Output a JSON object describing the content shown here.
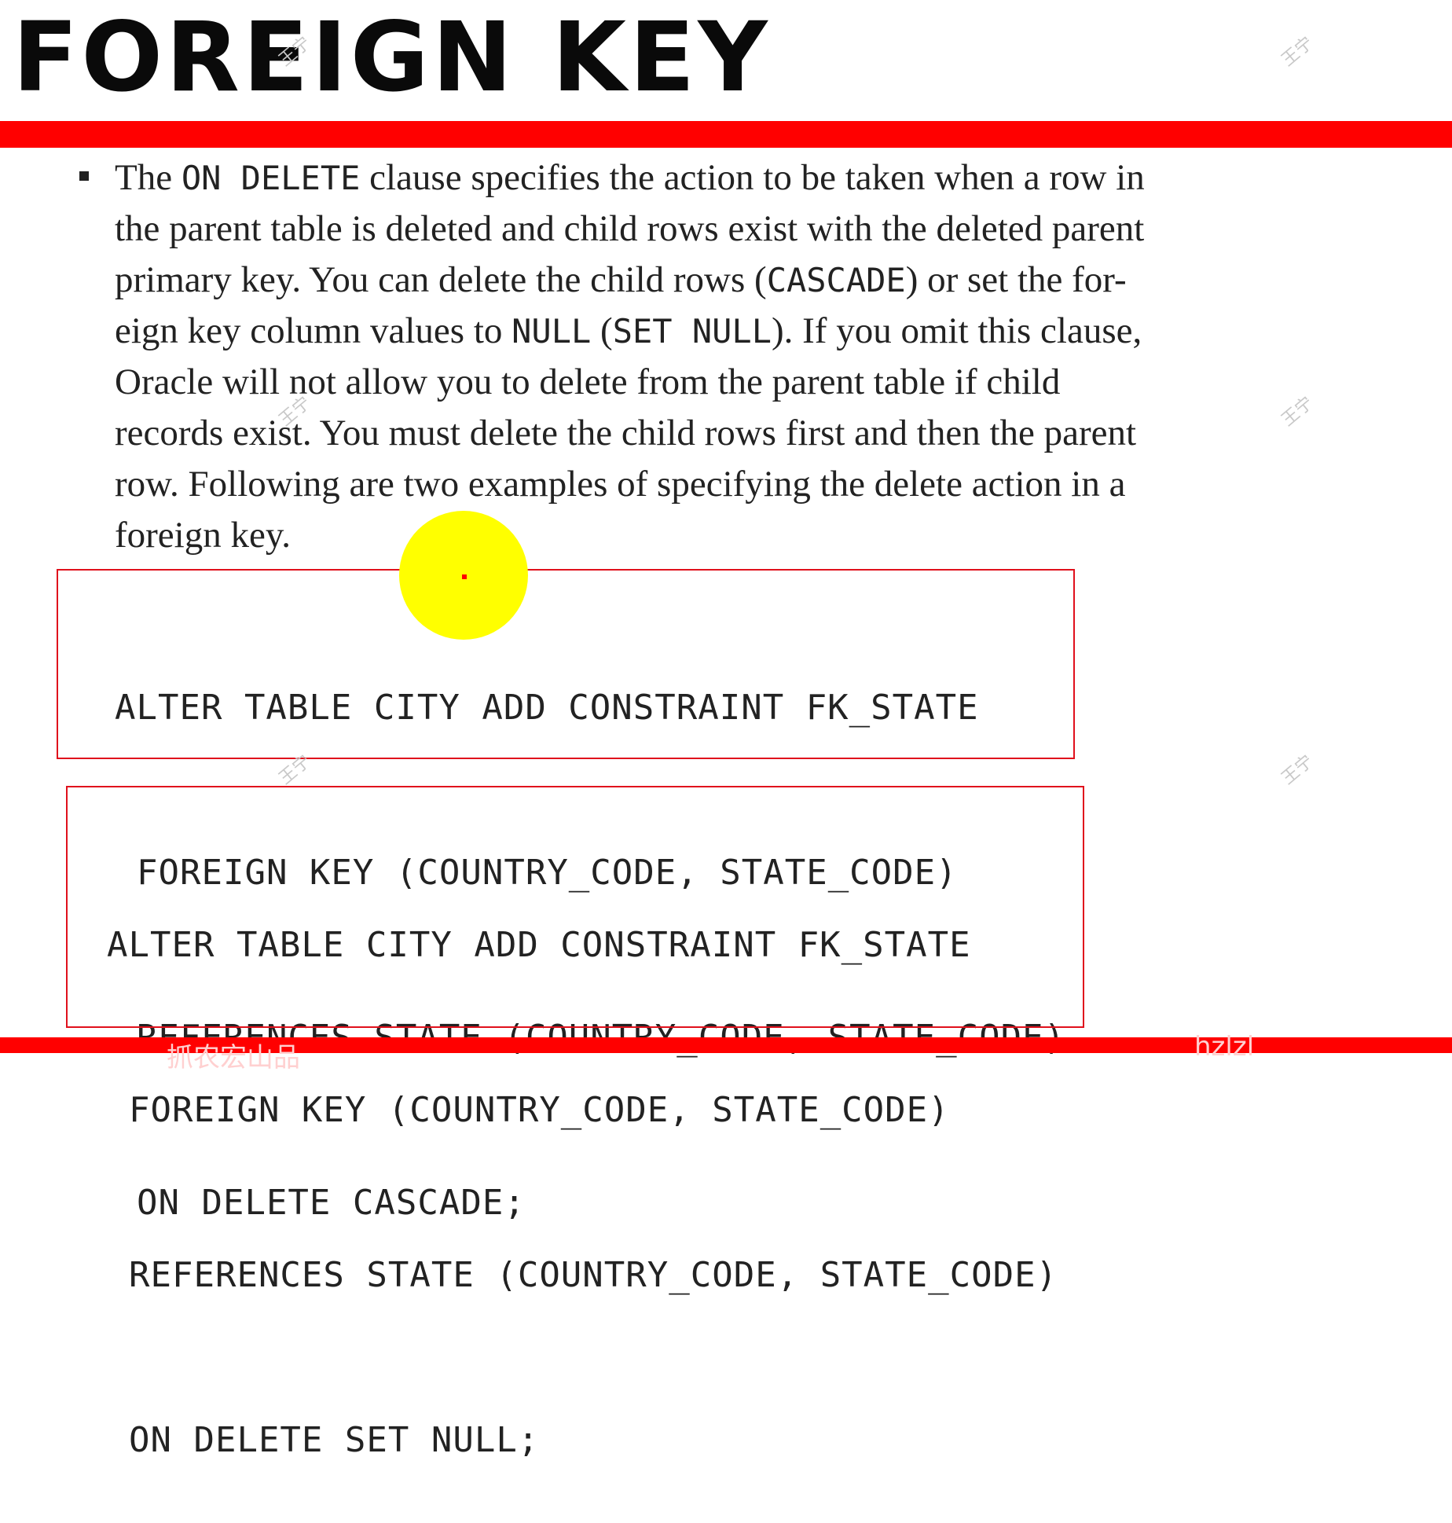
{
  "title": "FOREIGN KEY",
  "paragraph": {
    "lines": [
      [
        {
          "t": "The "
        },
        {
          "t": "ON DELETE",
          "mono": true
        },
        {
          "t": " clause specifies the action to be taken when a row in"
        }
      ],
      [
        {
          "t": "the parent table is deleted and child rows exist with the deleted parent"
        }
      ],
      [
        {
          "t": "primary key. You can delete the child rows ("
        },
        {
          "t": "CASCADE",
          "mono": true
        },
        {
          "t": ") or set the for-"
        }
      ],
      [
        {
          "t": "eign key column values to "
        },
        {
          "t": "NULL",
          "mono": true
        },
        {
          "t": " ("
        },
        {
          "t": "SET NULL",
          "mono": true
        },
        {
          "t": "). If you omit this clause,"
        }
      ],
      [
        {
          "t": "Oracle will not allow you to delete from the parent table if child"
        }
      ],
      [
        {
          "t": "records exist. You must delete the child rows first and then the parent"
        }
      ],
      [
        {
          "t": "row. Following are two examples of specifying the delete action in a"
        }
      ],
      [
        {
          "t": "foreign key."
        }
      ]
    ]
  },
  "code_example_1": {
    "line1": "ALTER TABLE CITY ADD CONSTRAINT FK_STATE",
    "line2": "FOREIGN KEY (COUNTRY_CODE, STATE_CODE)",
    "line3": "REFERENCES STATE (COUNTRY_CODE, STATE_CODE)",
    "line4": "ON DELETE CASCADE;"
  },
  "code_example_2": {
    "line1": "ALTER TABLE CITY ADD CONSTRAINT FK_STATE",
    "line2": "FOREIGN KEY (COUNTRY_CODE, STATE_CODE)",
    "line3": "REFERENCES STATE (COUNTRY_CODE, STATE_CODE)",
    "line4": "ON DELETE SET NULL;"
  },
  "watermark_text": "王宁",
  "footer": {
    "left": "抓农宏山品",
    "right": "hzlzl"
  },
  "colors": {
    "accent_red": "#ff0000",
    "box_outline": "#e0101c",
    "cursor_highlight": "#ffff00"
  }
}
